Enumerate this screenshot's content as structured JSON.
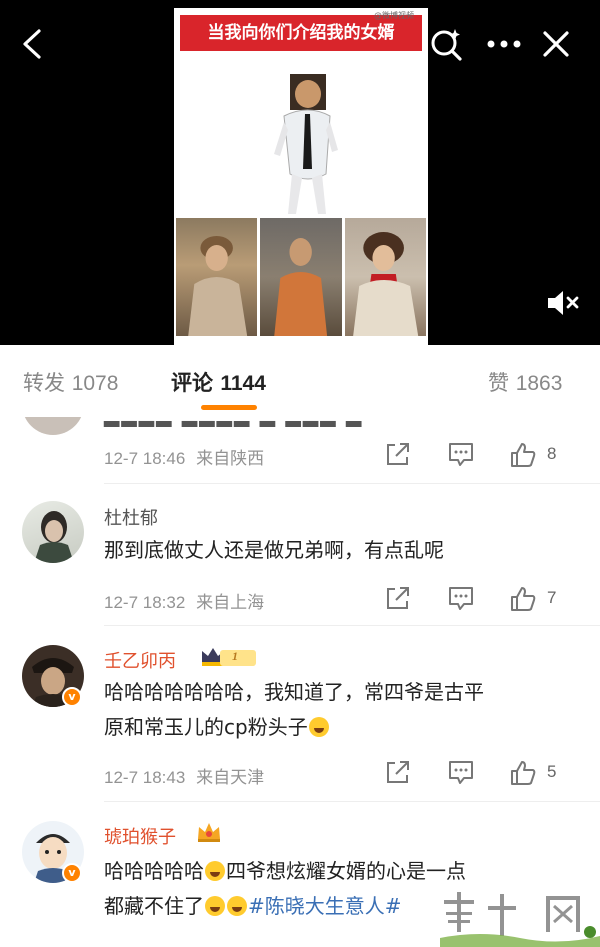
{
  "video": {
    "post_title": "当我向你们介绍我的女婿",
    "watermark": "@微博视频"
  },
  "tabs": {
    "repost_label": "转发",
    "repost_count": "1078",
    "comment_label": "评论",
    "comment_count": "1144",
    "like_label": "赞",
    "like_count": "1863"
  },
  "comments": [
    {
      "time": "12-7 18:46",
      "location": "来自陕西",
      "likes": "8"
    },
    {
      "username": "杜杜郁",
      "text": "那到底做丈人还是做兄弟啊，有点乱呢",
      "time": "12-7 18:32",
      "location": "来自上海",
      "likes": "7"
    },
    {
      "username": "壬乙卯丙",
      "badge_level": "1",
      "text_line1": "哈哈哈哈哈哈哈，我知道了，常四爷是古平",
      "text_line2": "原和常玉儿的cp粉头子",
      "time": "12-7 18:43",
      "location": "来自天津",
      "likes": "5"
    },
    {
      "username": "琥珀猴子",
      "text_line1_a": "哈哈哈哈哈",
      "text_line1_b": "四爷想炫耀女婿的心是一点",
      "text_line2_a": "都藏不住了",
      "topic": "#陈晓大生意人#"
    }
  ],
  "colors": {
    "accent": "#ff8200",
    "username_highlight": "#e0512e",
    "topic_link": "#3a6fb5"
  }
}
